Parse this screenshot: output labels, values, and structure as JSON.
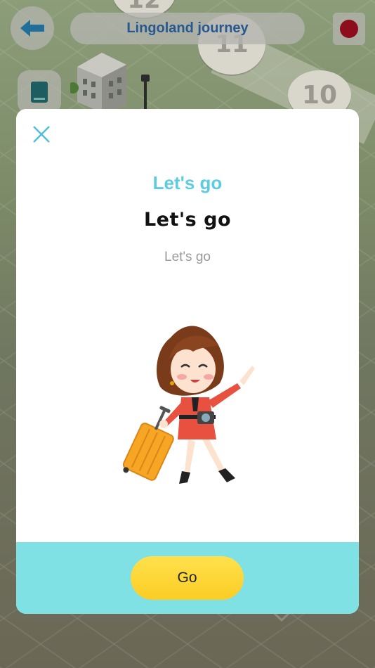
{
  "header": {
    "title": "Lingoland journey",
    "back_icon": "arrow-left-icon",
    "flag_icon": "flag-icon",
    "book_icon": "book-icon"
  },
  "map": {
    "levels": [
      "12",
      "11",
      "10"
    ]
  },
  "modal": {
    "close_icon": "close-icon",
    "primary_text": "Let's go",
    "secondary_text": "Let's go",
    "tertiary_text": "Let's go",
    "illustration": "traveler-woman-with-suitcase",
    "go_label": "Go"
  },
  "colors": {
    "title_text": "#27588f",
    "accent_cyan": "#5ccde0",
    "footer_bg": "#7fe1e3",
    "button_yellow": "#fbcd24",
    "flag_red": "#8e0d1d"
  }
}
